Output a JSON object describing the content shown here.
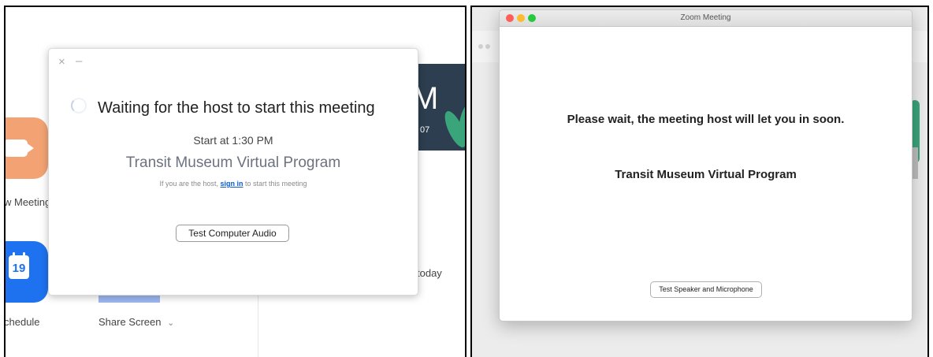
{
  "left": {
    "home": {
      "new_meeting_label": "w Meeting",
      "schedule_label": "chedule",
      "share_screen_label": "Share Screen",
      "share_chevron": "⌄",
      "today_label": "today",
      "calendar_day": "19",
      "banner_big": "M",
      "banner_small": "07"
    },
    "dialog": {
      "close_icon": "×",
      "minimize_icon": "–",
      "title": "Waiting for the host to start this meeting",
      "start_time": "Start at 1:30 PM",
      "program": "Transit Museum Virtual Program",
      "host_prefix": "If you are the host, ",
      "sign_in": "sign in",
      "host_suffix": " to start this meeting",
      "test_audio_button": "Test Computer Audio"
    }
  },
  "right": {
    "window_title": "Zoom Meeting",
    "message": "Please wait, the meeting host will let you in soon.",
    "program": "Transit Museum Virtual Program",
    "test_button": "Test Speaker and Microphone",
    "colors": {
      "close": "#fc5f57",
      "minimize": "#fdbc2e",
      "maximize": "#28c840"
    }
  }
}
